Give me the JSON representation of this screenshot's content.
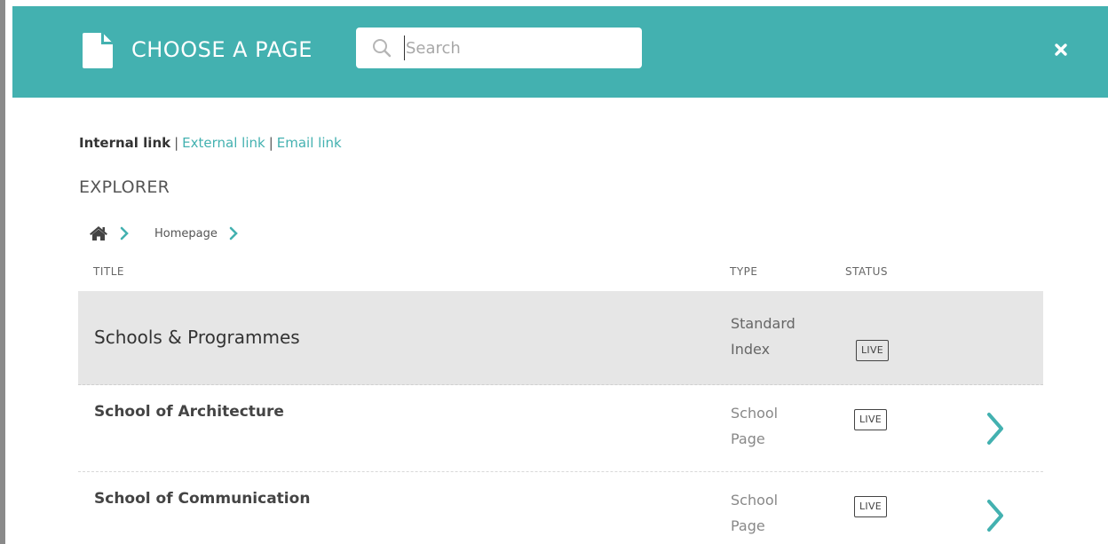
{
  "header": {
    "title": "CHOOSE A PAGE",
    "search_placeholder": "Search",
    "search_value": ""
  },
  "link_types": {
    "active": "Internal link",
    "external": "External link",
    "email": "Email link",
    "separator": "|"
  },
  "explorer": {
    "title": "EXPLORER",
    "breadcrumb": [
      "Homepage"
    ]
  },
  "table": {
    "headers": {
      "title": "TITLE",
      "type": "TYPE",
      "status": "STATUS"
    },
    "parent": {
      "title": "Schools & Programmes",
      "type_line1": "Standard",
      "type_line2": "Index",
      "status": "LIVE"
    },
    "rows": [
      {
        "title": "School of Architecture",
        "type_line1": "School",
        "type_line2": "Page",
        "status": "LIVE"
      },
      {
        "title": "School of Communication",
        "type_line1": "School",
        "type_line2": "Page",
        "status": "LIVE"
      }
    ]
  },
  "colors": {
    "accent": "#43b1b0",
    "parent_row_bg": "#e6e6e6"
  },
  "icons": {
    "header": "document-icon",
    "search": "search-icon",
    "close": "close-icon",
    "home": "home-icon",
    "chevron": "chevron-right-icon"
  }
}
